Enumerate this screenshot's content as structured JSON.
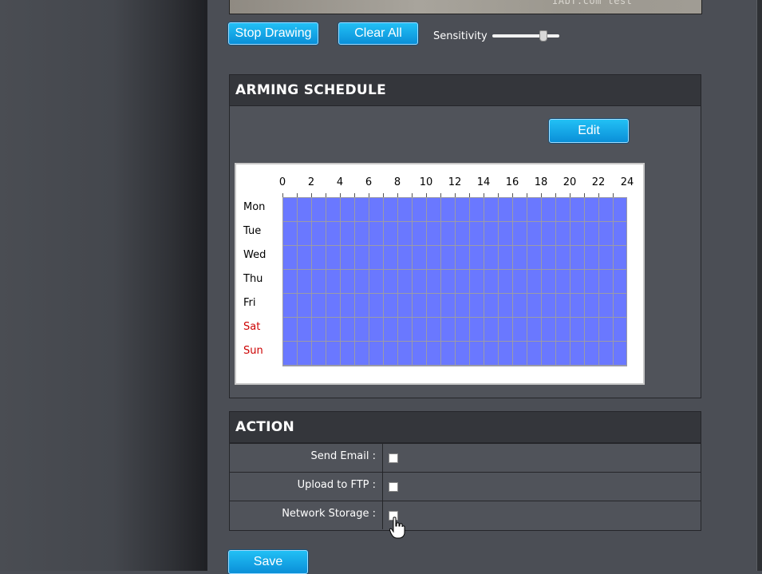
{
  "preview": {
    "overlay_text": "IAbT.com test"
  },
  "toolbar": {
    "stop_drawing_label": "Stop Drawing",
    "clear_all_label": "Clear All",
    "sensitivity_label": "Sensitivity",
    "sensitivity_level": 0.8
  },
  "arming_schedule": {
    "title": "ARMING SCHEDULE",
    "edit_label": "Edit",
    "hours": [
      "0",
      "2",
      "4",
      "6",
      "8",
      "10",
      "12",
      "14",
      "16",
      "18",
      "20",
      "22",
      "24"
    ],
    "days": [
      {
        "label": "Mon",
        "weekend": false
      },
      {
        "label": "Tue",
        "weekend": false
      },
      {
        "label": "Wed",
        "weekend": false
      },
      {
        "label": "Thu",
        "weekend": false
      },
      {
        "label": "Fri",
        "weekend": false
      },
      {
        "label": "Sat",
        "weekend": true
      },
      {
        "label": "Sun",
        "weekend": true
      }
    ],
    "all_slots_armed": true,
    "armed_color": "#6a78ff",
    "weekend_color": "#cc0000"
  },
  "action": {
    "title": "ACTION",
    "rows": [
      {
        "label": "Send Email :",
        "checked": false
      },
      {
        "label": "Upload to FTP :",
        "checked": false
      },
      {
        "label": "Network Storage :",
        "checked": false
      }
    ]
  },
  "save_label": "Save",
  "accent_color": "#0a8fd8"
}
